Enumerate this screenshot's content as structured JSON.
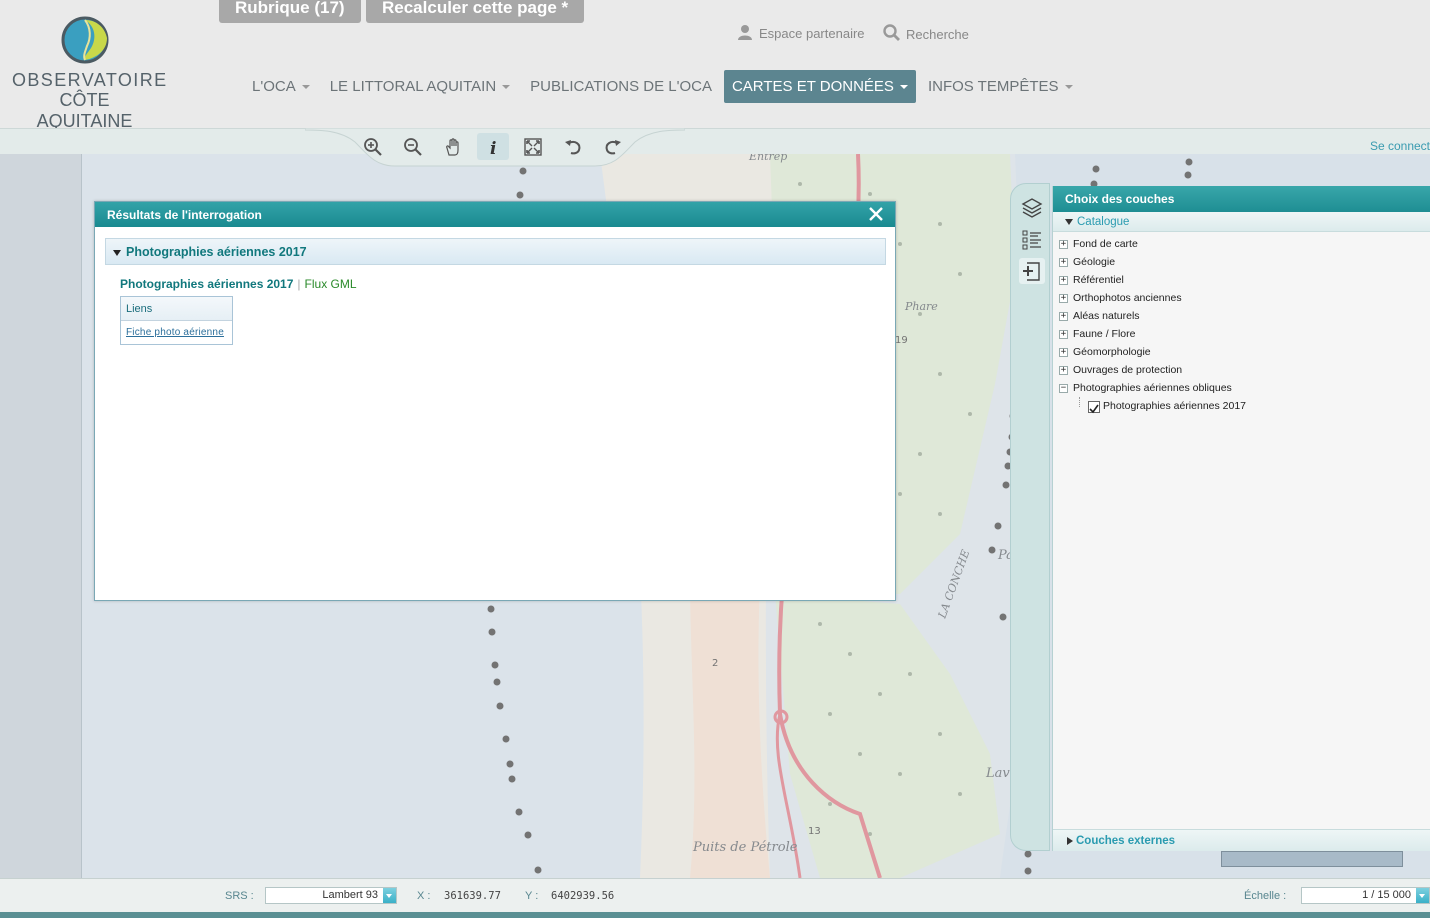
{
  "header": {
    "logo": {
      "line1": "OBSERVATOIRE",
      "line2": "CÔTE AQUITAINE"
    },
    "top_buttons": {
      "rubrique": "Rubrique (17)",
      "recalculer": "Recalculer cette page *"
    },
    "utility": {
      "partner": "Espace partenaire",
      "search": "Recherche"
    },
    "nav": [
      {
        "label": "L'OCA",
        "active": false
      },
      {
        "label": "LE LITTORAL AQUITAIN",
        "active": false
      },
      {
        "label": "PUBLICATIONS DE L'OCA",
        "active": false
      },
      {
        "label": "CARTES ET DONNÉES",
        "active": true
      },
      {
        "label": "INFOS TEMPÊTES",
        "active": false
      }
    ],
    "connect": "Se connect"
  },
  "toolbar": {
    "tools": [
      "zoom-in-icon",
      "zoom-out-icon",
      "pan-hand-icon",
      "info-icon",
      "zoom-extent-icon",
      "undo-icon",
      "redo-icon"
    ],
    "active_tool": "info-icon"
  },
  "dialog": {
    "title": "Résultats de l'interrogation",
    "section": "Photographies aériennes 2017",
    "result_title": "Photographies aériennes 2017",
    "separator": "|",
    "result_flux": "Flux GML",
    "links_header": "Liens",
    "links_item": "Fiche photo aérienne"
  },
  "map": {
    "labels": {
      "a": "Puits de Pétrole",
      "b": "LA CONCHE",
      "c": "Parc",
      "d": "Laverg",
      "e": "Phare",
      "f": "2",
      "g": "13",
      "h": "19",
      "i": "Entrep"
    }
  },
  "layers": {
    "title": "Choix des couches",
    "catalogue": "Catalogue",
    "items": [
      {
        "label": "Fond de carte",
        "expanded": false
      },
      {
        "label": "Géologie",
        "expanded": false
      },
      {
        "label": "Référentiel",
        "expanded": false
      },
      {
        "label": "Orthophotos anciennes",
        "expanded": false
      },
      {
        "label": "Aléas naturels",
        "expanded": false
      },
      {
        "label": "Faune / Flore",
        "expanded": false
      },
      {
        "label": "Géomorphologie",
        "expanded": false
      },
      {
        "label": "Ouvrages de protection",
        "expanded": false
      },
      {
        "label": "Photographies aériennes obliques",
        "expanded": true
      }
    ],
    "child": {
      "label": "Photographies aériennes 2017",
      "checked": true
    },
    "external": "Couches externes"
  },
  "status": {
    "srs_label": "SRS :",
    "srs_value": "Lambert 93",
    "x_label": "X :",
    "x_value": "361639.77",
    "y_label": "Y :",
    "y_value": "6402939.56",
    "scale_label": "Échelle :",
    "scale_value": "1 / 15 000"
  },
  "colors": {
    "accent": "#1a8a90",
    "nav_active": "#5c8590",
    "link": "#2c6f9b"
  }
}
